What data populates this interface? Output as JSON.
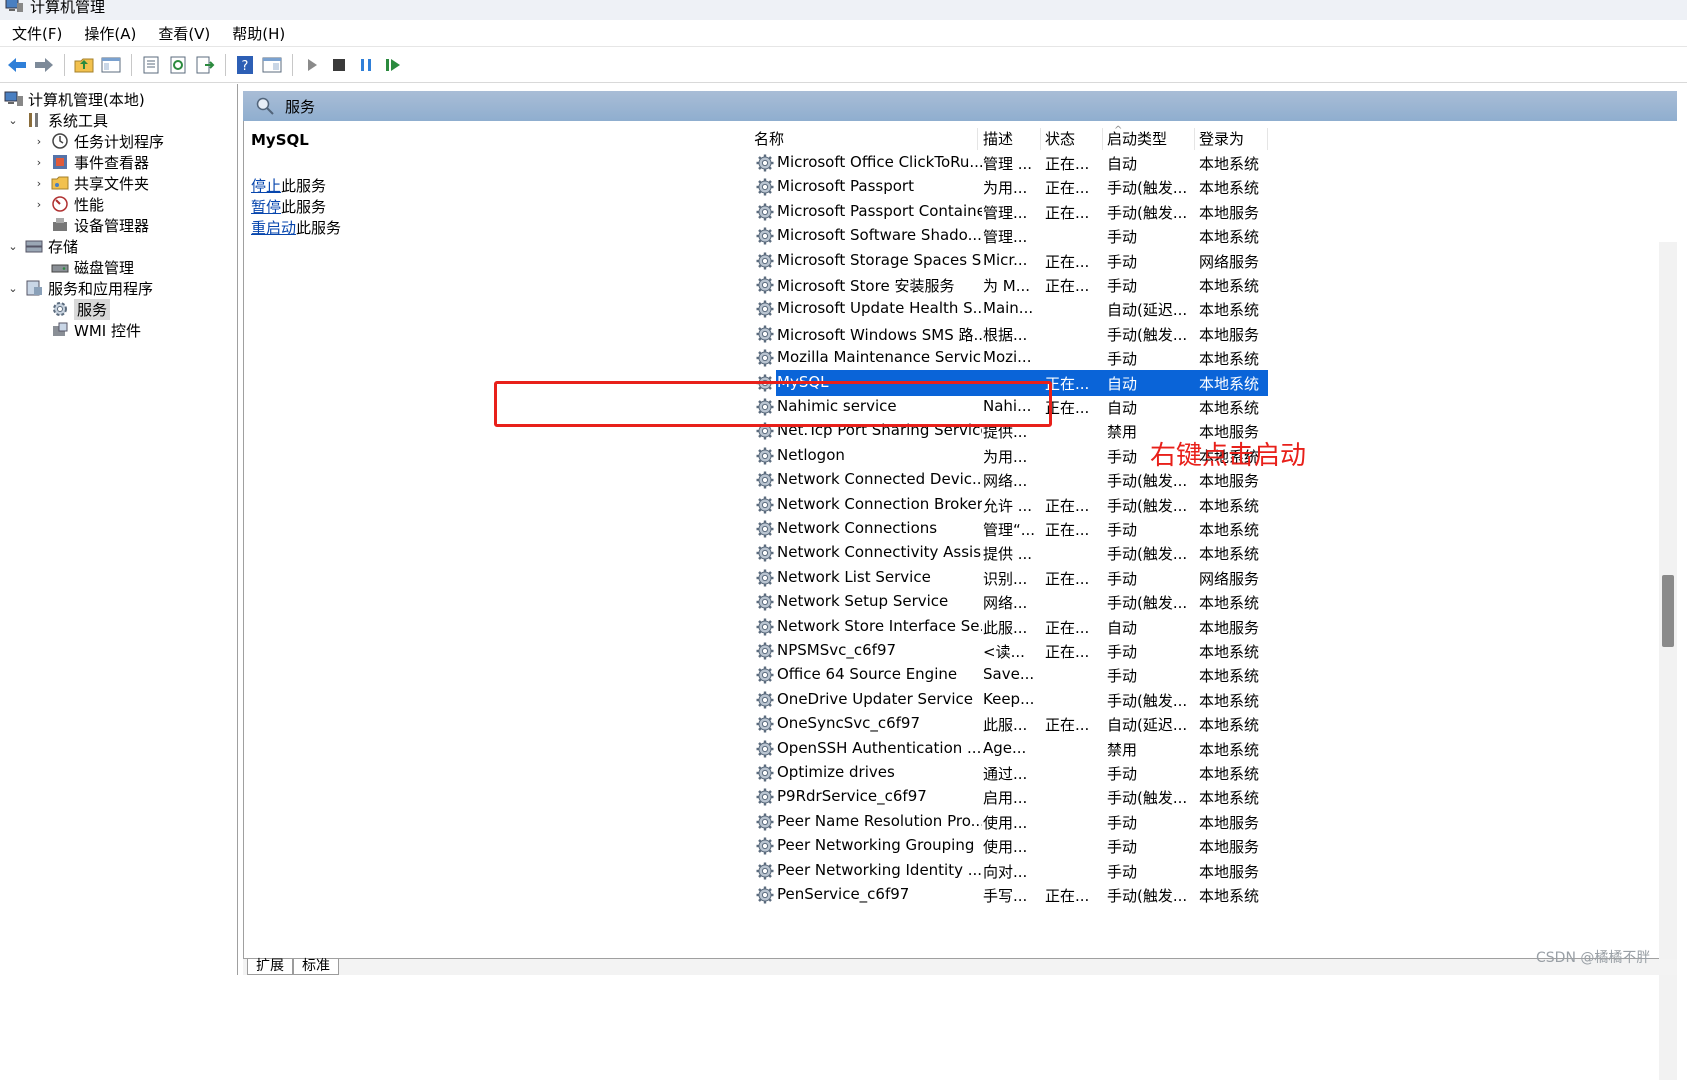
{
  "window": {
    "title": "计算机管理",
    "icon": "computer-management-icon"
  },
  "menu": [
    "文件(F)",
    "操作(A)",
    "查看(V)",
    "帮助(H)"
  ],
  "toolbar": {
    "buttons": [
      "back-icon",
      "forward-icon",
      "up-folder-icon",
      "show-hide-tree-icon",
      "properties-icon",
      "refresh-icon",
      "export-list-icon",
      "help-icon",
      "show-hide-action-pane-icon",
      "start-service-icon",
      "stop-service-icon",
      "pause-service-icon",
      "restart-service-icon"
    ]
  },
  "tree": {
    "root": "计算机管理(本地)",
    "system_tools": "系统工具",
    "task_scheduler": "任务计划程序",
    "event_viewer": "事件查看器",
    "shared_folders": "共享文件夹",
    "performance": "性能",
    "device_manager": "设备管理器",
    "storage": "存储",
    "disk_management": "磁盘管理",
    "services_apps": "服务和应用程序",
    "services": "服务",
    "wmi": "WMI 控件"
  },
  "pane": {
    "title": "服务"
  },
  "extended": {
    "service_name": "MySQL",
    "stop_link": "停止",
    "stop_suffix": "此服务",
    "pause_link": "暂停",
    "pause_suffix": "此服务",
    "restart_link": "重启动",
    "restart_suffix": "此服务"
  },
  "columns": {
    "name": "名称",
    "desc": "描述",
    "status": "状态",
    "startup": "启动类型",
    "logon": "登录为"
  },
  "rows": [
    {
      "name": "Microsoft Office ClickToRu...",
      "desc": "管理 ...",
      "status": "正在...",
      "startup": "自动",
      "logon": "本地系统"
    },
    {
      "name": "Microsoft Passport",
      "desc": "为用...",
      "status": "正在...",
      "startup": "手动(触发...",
      "logon": "本地系统"
    },
    {
      "name": "Microsoft Passport Container",
      "desc": "管理...",
      "status": "正在...",
      "startup": "手动(触发...",
      "logon": "本地服务"
    },
    {
      "name": "Microsoft Software Shado...",
      "desc": "管理...",
      "status": "",
      "startup": "手动",
      "logon": "本地系统"
    },
    {
      "name": "Microsoft Storage Spaces S...",
      "desc": "Micr...",
      "status": "正在...",
      "startup": "手动",
      "logon": "网络服务"
    },
    {
      "name": "Microsoft Store 安装服务",
      "desc": "为 M...",
      "status": "正在...",
      "startup": "手动",
      "logon": "本地系统"
    },
    {
      "name": "Microsoft Update Health S...",
      "desc": "Main...",
      "status": "",
      "startup": "自动(延迟...",
      "logon": "本地系统"
    },
    {
      "name": "Microsoft Windows SMS 路...",
      "desc": "根据...",
      "status": "",
      "startup": "手动(触发...",
      "logon": "本地服务"
    },
    {
      "name": "Mozilla Maintenance Service",
      "desc": "Mozi...",
      "status": "",
      "startup": "手动",
      "logon": "本地系统"
    },
    {
      "name": "MySQL",
      "desc": "",
      "status": "正在...",
      "startup": "自动",
      "logon": "本地系统",
      "selected": true
    },
    {
      "name": "Nahimic service",
      "desc": "Nahi...",
      "status": "正在...",
      "startup": "自动",
      "logon": "本地系统"
    },
    {
      "name": "Net.Tcp Port Sharing Service",
      "desc": "提供...",
      "status": "",
      "startup": "禁用",
      "logon": "本地服务"
    },
    {
      "name": "Netlogon",
      "desc": "为用...",
      "status": "",
      "startup": "手动",
      "logon": "本地系统"
    },
    {
      "name": "Network Connected Devic...",
      "desc": "网络...",
      "status": "",
      "startup": "手动(触发...",
      "logon": "本地服务"
    },
    {
      "name": "Network Connection Broker",
      "desc": "允许 ...",
      "status": "正在...",
      "startup": "手动(触发...",
      "logon": "本地系统"
    },
    {
      "name": "Network Connections",
      "desc": "管理“...",
      "status": "正在...",
      "startup": "手动",
      "logon": "本地系统"
    },
    {
      "name": "Network Connectivity Assis...",
      "desc": "提供 ...",
      "status": "",
      "startup": "手动(触发...",
      "logon": "本地系统"
    },
    {
      "name": "Network List Service",
      "desc": "识别...",
      "status": "正在...",
      "startup": "手动",
      "logon": "网络服务"
    },
    {
      "name": "Network Setup Service",
      "desc": "网络...",
      "status": "",
      "startup": "手动(触发...",
      "logon": "本地系统"
    },
    {
      "name": "Network Store Interface Se...",
      "desc": "此服...",
      "status": "正在...",
      "startup": "自动",
      "logon": "本地服务"
    },
    {
      "name": "NPSMSvc_c6f97",
      "desc": "<读...",
      "status": "正在...",
      "startup": "手动",
      "logon": "本地系统"
    },
    {
      "name": "Office 64 Source Engine",
      "desc": "Save...",
      "status": "",
      "startup": "手动",
      "logon": "本地系统"
    },
    {
      "name": "OneDrive Updater Service",
      "desc": "Keep...",
      "status": "",
      "startup": "手动(触发...",
      "logon": "本地系统"
    },
    {
      "name": "OneSyncSvc_c6f97",
      "desc": "此服...",
      "status": "正在...",
      "startup": "自动(延迟...",
      "logon": "本地系统"
    },
    {
      "name": "OpenSSH Authentication ...",
      "desc": "Age...",
      "status": "",
      "startup": "禁用",
      "logon": "本地系统"
    },
    {
      "name": "Optimize drives",
      "desc": "通过...",
      "status": "",
      "startup": "手动",
      "logon": "本地系统"
    },
    {
      "name": "P9RdrService_c6f97",
      "desc": "启用...",
      "status": "",
      "startup": "手动(触发...",
      "logon": "本地系统"
    },
    {
      "name": "Peer Name Resolution Pro...",
      "desc": "使用...",
      "status": "",
      "startup": "手动",
      "logon": "本地服务"
    },
    {
      "name": "Peer Networking Grouping",
      "desc": "使用...",
      "status": "",
      "startup": "手动",
      "logon": "本地服务"
    },
    {
      "name": "Peer Networking Identity ...",
      "desc": "向对...",
      "status": "",
      "startup": "手动",
      "logon": "本地服务"
    },
    {
      "name": "PenService_c6f97",
      "desc": "手写...",
      "status": "正在...",
      "startup": "手动(触发...",
      "logon": "本地系统"
    }
  ],
  "annotation": "右键点击启动",
  "tabs": [
    "扩展",
    "标准"
  ],
  "watermark": "CSDN @橘橘不胖",
  "colors": {
    "selection": "#0a64d8",
    "annotation": "#e8201a",
    "pane_header": "#9ab5d3",
    "link": "#0645ad"
  }
}
